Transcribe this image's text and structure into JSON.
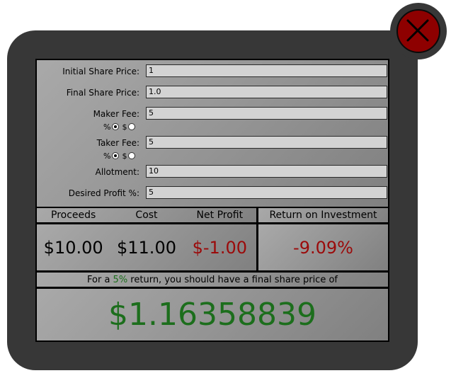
{
  "form": {
    "initial_price_label": "Initial Share Price:",
    "initial_price_value": "1",
    "final_price_label": "Final Share Price:",
    "final_price_value": "1.0",
    "maker_fee_label": "Maker Fee:",
    "maker_fee_value": "5",
    "maker_fee_percent_symbol": "%",
    "maker_fee_dollar_symbol": "$",
    "taker_fee_label": "Taker Fee:",
    "taker_fee_value": "5",
    "taker_fee_percent_symbol": "%",
    "taker_fee_dollar_symbol": "$",
    "allotment_label": "Allotment:",
    "allotment_value": "10",
    "desired_profit_label": "Desired Profit %:",
    "desired_profit_value": "5"
  },
  "results": {
    "proceeds_header": "Proceeds",
    "cost_header": "Cost",
    "net_profit_header": "Net Profit",
    "roi_header": "Return on Investment",
    "proceeds_value": "$10.00",
    "cost_value": "$11.00",
    "net_profit_value": "$-1.00",
    "roi_value": "-9.09%"
  },
  "target": {
    "message_prefix": "For a ",
    "message_percent": "5%",
    "message_suffix": " return, you should have a final share price of",
    "price": "$1.16358839"
  },
  "colors": {
    "window_bg": "#373737",
    "close_button": "#8e0000",
    "negative_value": "#9b0a0a",
    "positive_value": "#1c6e1c"
  },
  "icons": {
    "close": "close-x-icon"
  }
}
